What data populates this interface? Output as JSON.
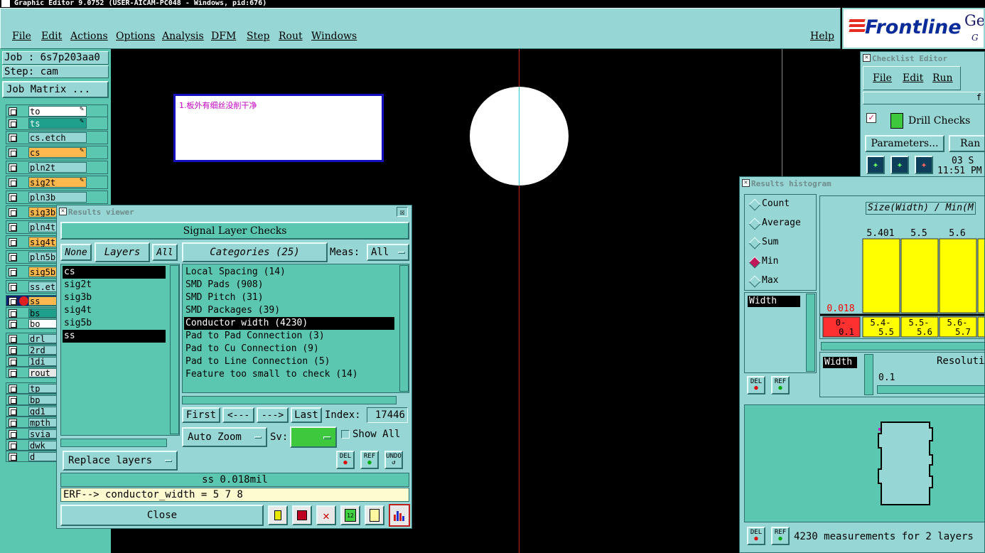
{
  "window": {
    "title": "Graphic Editor 9.0752 (USER-AICAM-PC048 - Windows, pid:676)"
  },
  "menu": {
    "file": "File",
    "edit": "Edit",
    "actions": "Actions",
    "options": "Options",
    "analysis": "Analysis",
    "dfm": "DFM",
    "step": "Step",
    "rout": "Rout",
    "windows": "Windows",
    "help": "Help"
  },
  "brand": {
    "logo": "Frontline",
    "tail": "Ge",
    "tail2": "G"
  },
  "job": {
    "job_label": "Job : 6s7p203aa0",
    "step_label": "Step: cam",
    "matrix_button": "Job Matrix ..."
  },
  "layers": [
    "to",
    "ts",
    "cs.etch",
    "cs",
    "pln2t",
    "sig2t",
    "pln3b",
    "sig3b",
    "pln4t",
    "sig4t",
    "pln5b",
    "sig5b",
    "ss.et",
    "ss",
    "bs",
    "bo",
    "drl",
    "2rd",
    "1di",
    "rout",
    "tp",
    "bp",
    "gd1",
    "mpth",
    "svia",
    "dwk",
    "d"
  ],
  "note": {
    "text": "1.板外有细丝没削干净"
  },
  "results_viewer": {
    "title": "Results viewer",
    "close_x": "☒",
    "header": "Signal Layer Checks",
    "none_button": "None",
    "layers_button": "Layers",
    "all_button": "All",
    "categories_button": "Categories (25)",
    "meas_label": "Meas:",
    "meas_value": "All",
    "layer_list": [
      "cs",
      "sig2t",
      "sig3b",
      "sig4t",
      "sig5b",
      "ss"
    ],
    "categories": [
      "Local Spacing (14)",
      "SMD Pads (908)",
      "SMD Pitch (31)",
      "SMD Packages (39)",
      "Conductor width (4230)",
      "Pad to Pad Connection (3)",
      "Pad to Cu Connection (9)",
      "Pad to Line Connection (5)",
      "Feature too small to check (14)"
    ],
    "first_button": "First",
    "prev_button": "<---",
    "next_button": "--->",
    "last_button": "Last",
    "index_label": "Index:",
    "index_value": "17446",
    "auto_zoom": "Auto Zoom",
    "sv_label": "Sv:",
    "show_all": "Show All",
    "replace_layers": "Replace layers",
    "del": "DEL",
    "ref": "REF",
    "undo": "UNDO",
    "status": "ss 0.018mil",
    "erf": "ERF--> conductor_width = 5 7 8",
    "close_button": "Close",
    "icon_12": "12"
  },
  "checklist": {
    "title": "Checklist Editor",
    "file": "File",
    "edit": "Edit",
    "run": "Run",
    "partial_top": "f",
    "drill_checks": "Drill Checks",
    "parameters": "Parameters...",
    "ran": "Ran",
    "date": "03 S",
    "time": "11:51 PM"
  },
  "histogram": {
    "title": "Results histogram",
    "options": [
      "Count",
      "Average",
      "Sum",
      "Min",
      "Max"
    ],
    "selected_option": "Min",
    "width_item": "Width",
    "axis_title": "Size(Width) / Min(M",
    "resolution_label": "Resoluti",
    "resolution_value": "0.1",
    "width_label": "Width",
    "del": "DEL",
    "ref": "REF",
    "measurements": "4230 measurements for 2 layers"
  },
  "chart_data": {
    "type": "bar",
    "categories": [
      "0-0.1",
      "5.4-5.5",
      "5.5-5.6",
      "5.6-5.7",
      ""
    ],
    "values": [
      0.018,
      5.401,
      5.5,
      5.6,
      5.6
    ],
    "labels": [
      "0.018",
      "5.401",
      "5.5",
      "5.6",
      ""
    ],
    "ylim": [
      0,
      7
    ],
    "colors": {
      "bar": "#ffff00",
      "first_bin": "#ff3030",
      "low_label": "#ff0000"
    }
  }
}
